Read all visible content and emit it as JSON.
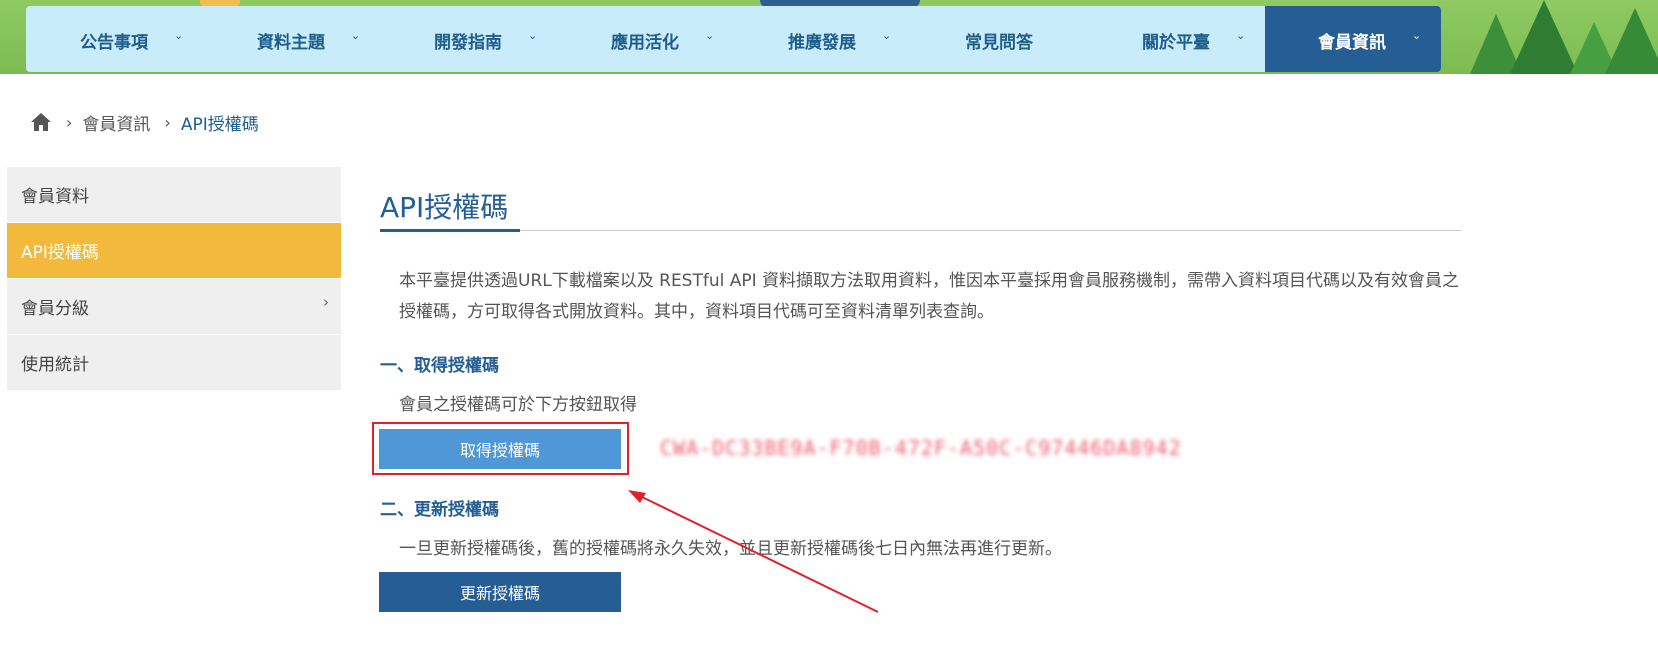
{
  "nav": {
    "items": [
      {
        "label": "公告事項",
        "chevron": "⌄"
      },
      {
        "label": "資料主題",
        "chevron": "⌄"
      },
      {
        "label": "開發指南",
        "chevron": "⌄"
      },
      {
        "label": "應用活化",
        "chevron": "⌄"
      },
      {
        "label": "推廣發展",
        "chevron": "⌄"
      },
      {
        "label": "常見問答",
        "chevron": ""
      },
      {
        "label": "關於平臺",
        "chevron": "⌄"
      },
      {
        "label": "會員資訊",
        "chevron": "⌄"
      }
    ],
    "active_index": 7,
    "active_color": "#245e95"
  },
  "breadcrumb": {
    "home_icon": "home-icon",
    "separator": "›",
    "items": [
      "會員資訊",
      "API授權碼"
    ]
  },
  "sidebar": {
    "items": [
      {
        "label": "會員資料"
      },
      {
        "label": "API授權碼"
      },
      {
        "label": "會員分級",
        "has_submenu": true,
        "arrow": "›"
      },
      {
        "label": "使用統計"
      }
    ],
    "active_index": 1,
    "active_color": "#f2b93d"
  },
  "main": {
    "title": "API授權碼",
    "intro": "本平臺提供透過URL下載檔案以及 RESTful API 資料擷取方法取用資料，惟因本平臺採用會員服務機制，需帶入資料項目代碼以及有效會員之授權碼，方可取得各式開放資料。其中，資料項目代碼可至資料清單列表查詢。",
    "section1": {
      "heading": "一、取得授權碼",
      "text": "會員之授權碼可於下方按鈕取得",
      "button_label": "取得授權碼",
      "token_value": "CWA-DC33BE9A-F70B-472F-A50C-C97446DA8942"
    },
    "section2": {
      "heading": "二、更新授權碼",
      "text": "一旦更新授權碼後，舊的授權碼將永久失效，並且更新授權碼後七日內無法再進行更新。",
      "button_label": "更新授權碼"
    }
  },
  "annotation": {
    "box_color": "#e0202a",
    "arrow_color": "#e0202a"
  }
}
